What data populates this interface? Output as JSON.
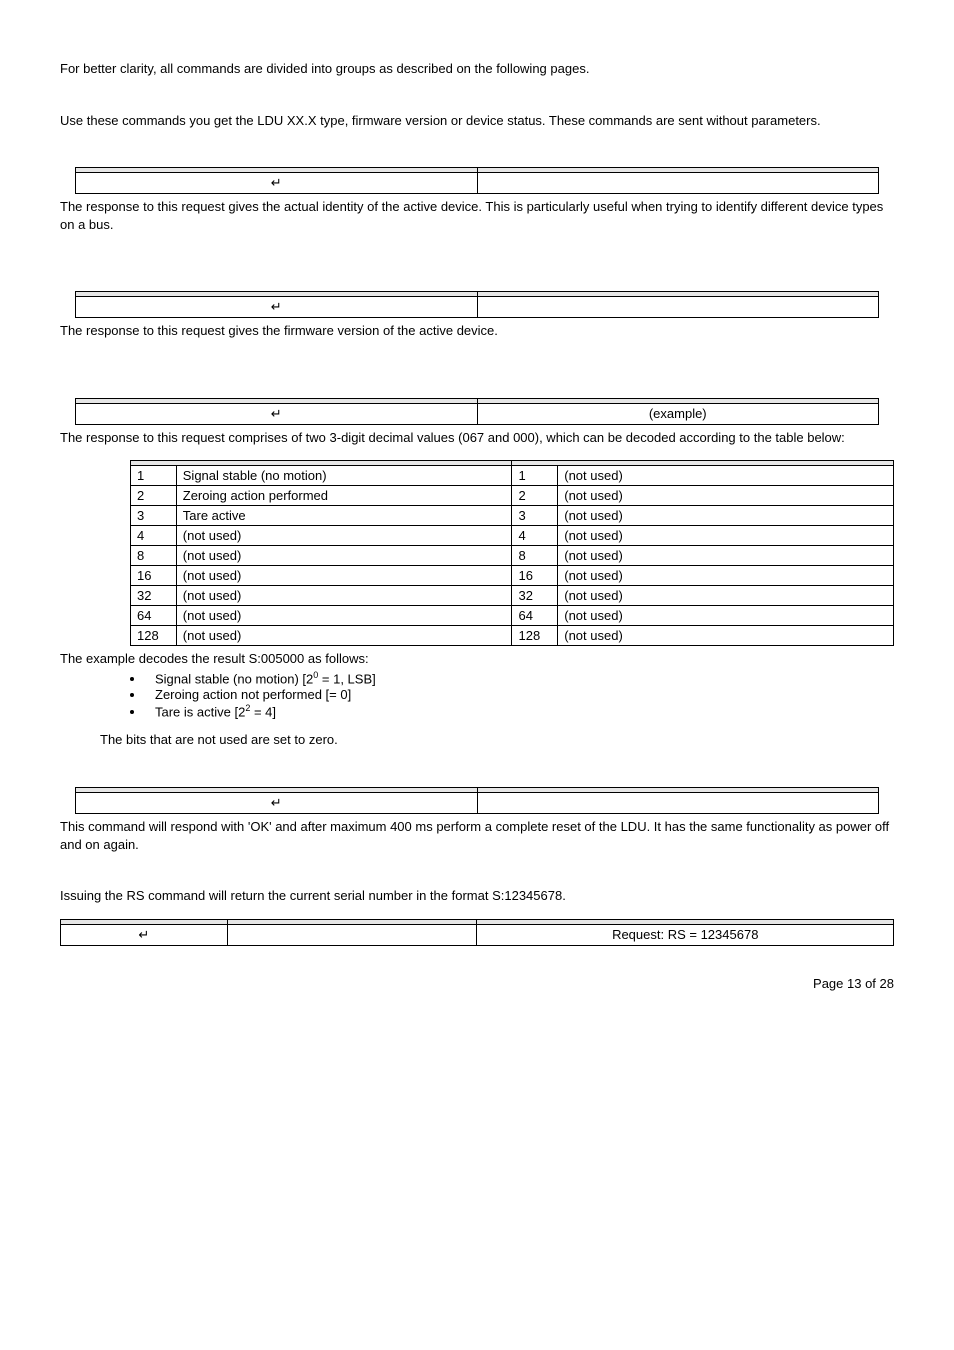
{
  "intro": "For better clarity, all commands are divided into groups as described on the following pages.",
  "system_intro": "Use these commands you get the LDU XX.X type, firmware version or device status. These commands are sent without parameters.",
  "enter_symbol": "↵",
  "id_desc": "The response to this request gives the actual identity of the active device. This is particularly useful when trying to identify different device types on a bus.",
  "iv_desc": "The response to this request gives the firmware version of the active device.",
  "is_example": "(example)",
  "is_desc": "The response to this request comprises of two 3-digit decimal values (067 and 000), which can be decoded according to the table below:",
  "status_rows": [
    {
      "l_code": "1",
      "l_desc": "Signal stable (no motion)",
      "r_code": "1",
      "r_desc": "(not used)"
    },
    {
      "l_code": "2",
      "l_desc": "Zeroing action performed",
      "r_code": "2",
      "r_desc": "(not used)"
    },
    {
      "l_code": "3",
      "l_desc": "Tare active",
      "r_code": "3",
      "r_desc": "(not used)"
    },
    {
      "l_code": "4",
      "l_desc": "(not used)",
      "r_code": "4",
      "r_desc": "(not used)"
    },
    {
      "l_code": "8",
      "l_desc": "(not used)",
      "r_code": "8",
      "r_desc": "(not used)"
    },
    {
      "l_code": "16",
      "l_desc": "(not used)",
      "r_code": "16",
      "r_desc": "(not used)"
    },
    {
      "l_code": "32",
      "l_desc": "(not used)",
      "r_code": "32",
      "r_desc": "(not used)"
    },
    {
      "l_code": "64",
      "l_desc": "(not used)",
      "r_code": "64",
      "r_desc": "(not used)"
    },
    {
      "l_code": "128",
      "l_desc": "(not used)",
      "r_code": "128",
      "r_desc": "(not used)"
    }
  ],
  "decode_intro": "The example decodes the result S:005000 as follows:",
  "bullets": {
    "b1_pre": "Signal stable (no motion) [2",
    "b1_sup": "0",
    "b1_post": " = 1, LSB]",
    "b2": "Zeroing action not performed [= 0]",
    "b3_pre": "Tare is active [2",
    "b3_sup": "2",
    "b3_post": " = 4]"
  },
  "bits_zero": "The bits that are not used are set to zero.",
  "sr_desc": "This command will respond with 'OK' and after maximum 400 ms perform a complete reset of the LDU.  It has the same functionality as power off and on again.",
  "rs_intro": "Issuing the RS command will return the current serial number in the format S:12345678.",
  "rs_request": "Request: RS = 12345678",
  "page_footer": "Page 13 of 28"
}
